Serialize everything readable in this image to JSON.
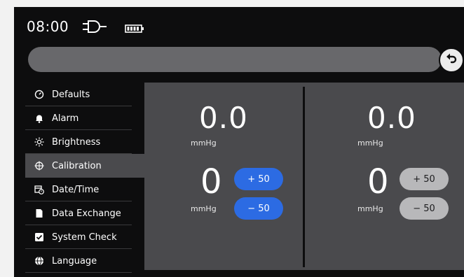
{
  "status": {
    "time": "08:00"
  },
  "menu": {
    "items": [
      {
        "label": "Defaults",
        "icon": "gauge-icon"
      },
      {
        "label": "Alarm",
        "icon": "bell-icon"
      },
      {
        "label": "Brightness",
        "icon": "sun-icon"
      },
      {
        "label": "Calibration",
        "icon": "crosshair-icon",
        "active": true
      },
      {
        "label": "Date/Time",
        "icon": "calendar-clock-icon"
      },
      {
        "label": "Data Exchange",
        "icon": "document-icon"
      },
      {
        "label": "System Check",
        "icon": "checkbox-icon"
      },
      {
        "label": "Language",
        "icon": "globe-icon"
      }
    ]
  },
  "left": {
    "pressure": "0.0",
    "pressure_unit": "mmHg",
    "offset": "0",
    "offset_unit": "mmHg",
    "plus_label": "+ 50",
    "minus_label": "− 50"
  },
  "right": {
    "pressure": "0.0",
    "pressure_unit": "mmHg",
    "offset": "0",
    "offset_unit": "mmHg",
    "plus_label": "+ 50",
    "minus_label": "− 50"
  },
  "colors": {
    "accent": "#2c6be3",
    "panel": "#4a4a4d",
    "background": "#0d0d0e"
  }
}
